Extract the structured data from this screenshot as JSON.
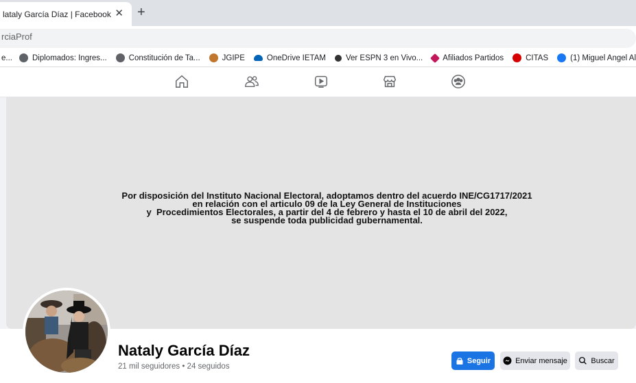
{
  "browser": {
    "tab_title": "lataly García Díaz | Facebook",
    "tab_close": "✕",
    "new_tab": "+",
    "url": "rciaProf"
  },
  "bookmarks": [
    {
      "label": "e...",
      "color": ""
    },
    {
      "label": "Diplomados: Ingres...",
      "color": "#5f6368"
    },
    {
      "label": "Constitución de Ta...",
      "color": "#5f6368"
    },
    {
      "label": "JGIPE",
      "color": "#c0762d"
    },
    {
      "label": "OneDrive IETAM",
      "color": "#0364b8"
    },
    {
      "label": "Ver ESPN 3 en Vivo...",
      "color": "#333333"
    },
    {
      "label": "Afiliados Partidos",
      "color": "#c2185b"
    },
    {
      "label": "CITAS",
      "color": "#d50000"
    },
    {
      "label": "(1) Miguel Angel Al",
      "color": "#1877f2"
    }
  ],
  "nav": {
    "icons": [
      "home-icon",
      "friends-icon",
      "watch-icon",
      "marketplace-icon",
      "groups-icon"
    ]
  },
  "cover": {
    "line1": "Por disposición del Instituto Nacional Electoral, adoptamos dentro del acuerdo INE/CG1717/2021",
    "line2": "en relación con el articulo 09 de la Ley General de Instituciones",
    "line3": "y  Procedimientos Electorales, a partir del 4 de febrero y hasta el 10 de abril del 2022,",
    "line4": "se suspende toda publicidad gubernamental."
  },
  "profile": {
    "name": "Nataly García Díaz",
    "stats": "21 mil seguidores • 24 seguidos"
  },
  "actions": {
    "follow_label": "Seguir",
    "message_label": "Enviar mensaje",
    "search_label": "Buscar"
  },
  "colors": {
    "facebook_blue": "#1b74e4",
    "button_gray": "#e4e6eb"
  }
}
